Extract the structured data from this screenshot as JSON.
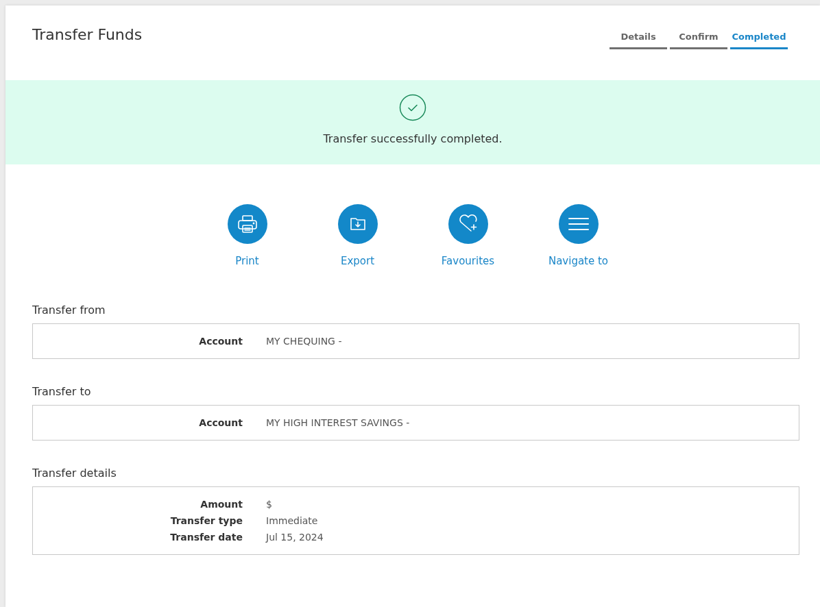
{
  "title": "Transfer Funds",
  "steps": [
    {
      "label": "Details",
      "selected": false
    },
    {
      "label": "Confirm",
      "selected": false
    },
    {
      "label": "Completed",
      "selected": true
    }
  ],
  "banner": {
    "message": "Transfer successfully completed."
  },
  "actions": [
    {
      "kind": "print",
      "label": "Print"
    },
    {
      "kind": "export",
      "label": "Export"
    },
    {
      "kind": "favourite",
      "label": "Favourites"
    },
    {
      "kind": "menu",
      "label": "Navigate to"
    }
  ],
  "sections": [
    {
      "title": "Transfer from",
      "rows": [
        {
          "label": "Account",
          "value": "MY CHEQUING -"
        }
      ]
    },
    {
      "title": "Transfer to",
      "rows": [
        {
          "label": "Account",
          "value": "MY HIGH INTEREST SAVINGS -"
        }
      ]
    },
    {
      "title": "Transfer details",
      "rows": [
        {
          "label": "Amount",
          "value": "$"
        },
        {
          "label": "Transfer type",
          "value": "Immediate"
        },
        {
          "label": "Transfer date",
          "value": "Jul 15, 2024"
        }
      ]
    }
  ]
}
